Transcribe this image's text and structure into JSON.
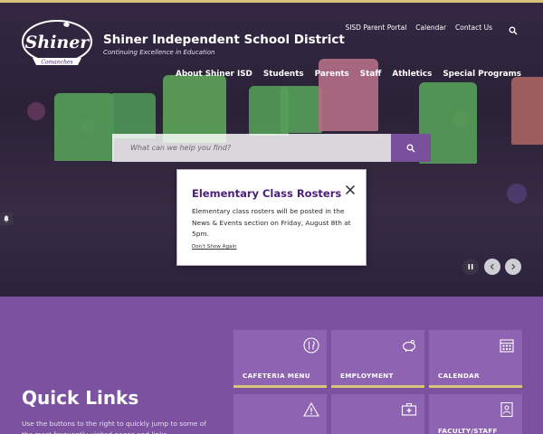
{
  "logo": {
    "wordmark": "Shiner",
    "ribbon": "Comanches"
  },
  "site": {
    "title": "Shiner Independent School District",
    "tagline": "Continuing Excellence in Education"
  },
  "utility_nav": [
    "SISD Parent Portal",
    "Calendar",
    "Contact Us"
  ],
  "main_nav": [
    "About Shiner ISD",
    "Students",
    "Parents",
    "Staff",
    "Athletics",
    "Special Programs"
  ],
  "search": {
    "placeholder": "What can we help you find?"
  },
  "modal": {
    "title": "Elementary Class Rosters",
    "body": "Elementary class rosters will be posted in the News & Events section on Friday, August 8th at 5pm.",
    "dismiss_link": "Don't Show Again"
  },
  "quick_links": {
    "title": "Quick Links",
    "description": "Use the buttons to the right to quickly jump to some of the most frequently visited pages and links.",
    "tiles": [
      {
        "label": "CAFETERIA MENU",
        "icon": "utensils-icon"
      },
      {
        "label": "EMPLOYMENT",
        "icon": "piggy-bank-icon"
      },
      {
        "label": "CALENDAR",
        "icon": "calendar-icon"
      },
      {
        "label": "",
        "icon": "warning-icon"
      },
      {
        "label": "",
        "icon": "first-aid-kit-icon"
      },
      {
        "label": "FACULTY/STAFF",
        "icon": "contact-book-icon"
      }
    ]
  },
  "colors": {
    "purple": "#7c52a0",
    "tile": "#8e63b1",
    "gold": "#d9c27a",
    "title_purple": "#4b1e78"
  }
}
